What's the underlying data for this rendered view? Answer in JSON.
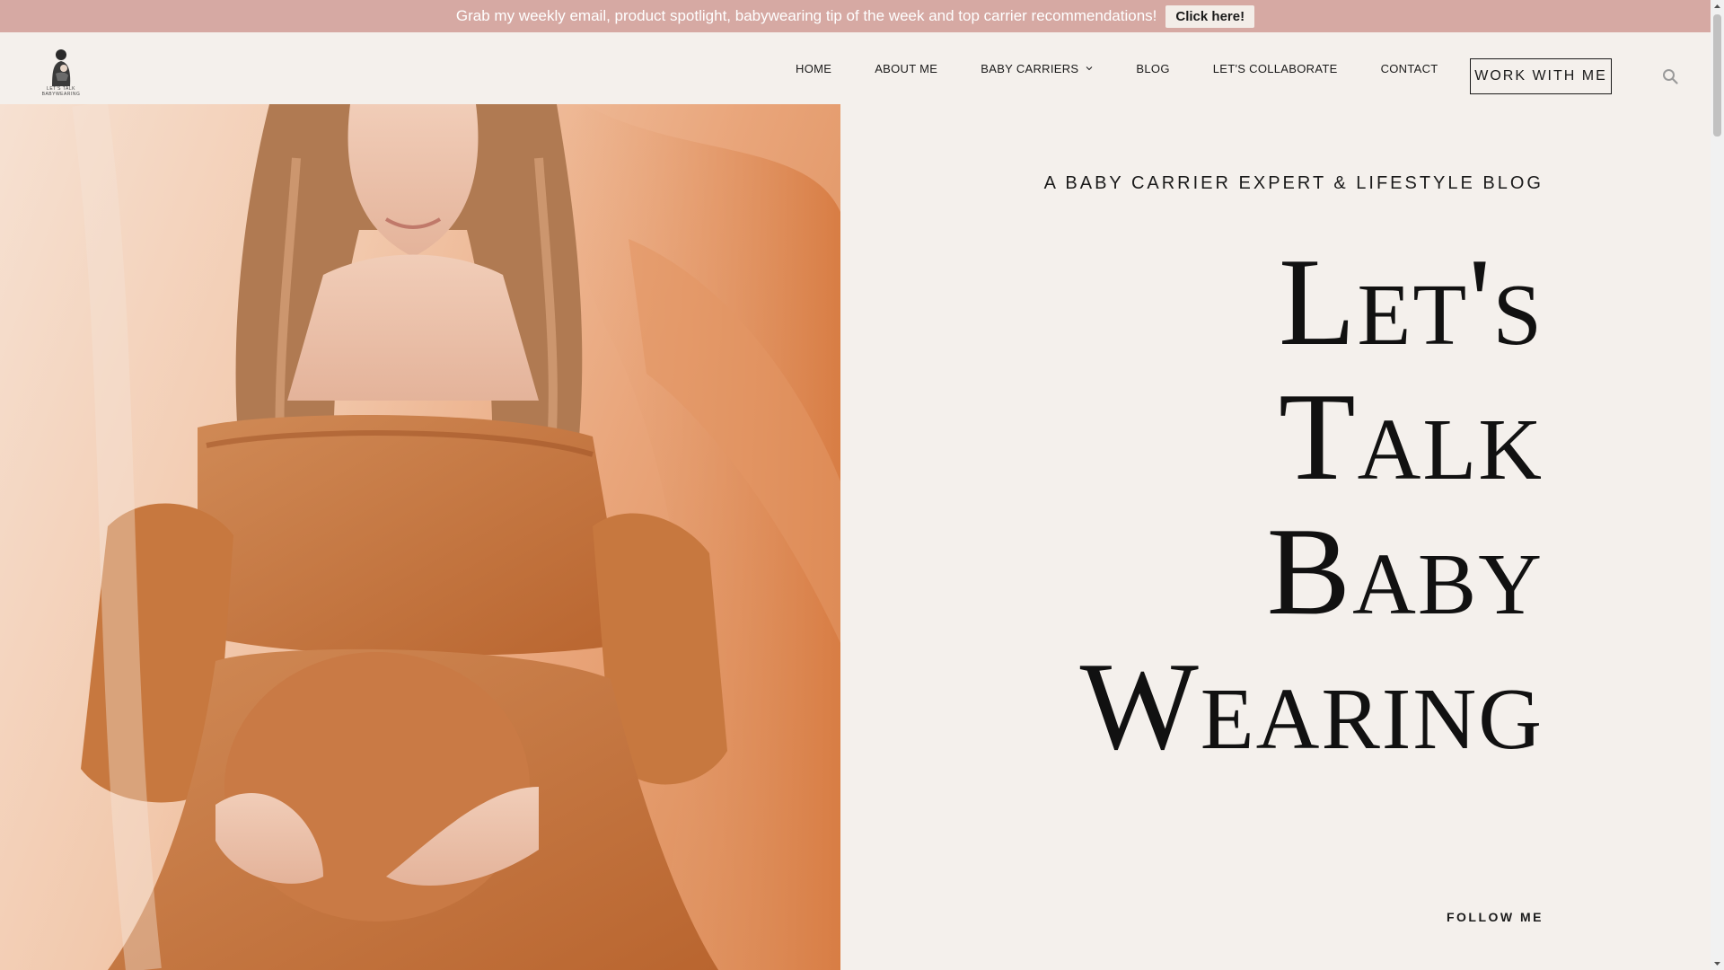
{
  "announcement": {
    "text": "Grab my weekly email, product spotlight, babywearing tip of the week and top carrier recommendations!",
    "button_label": "Click here!"
  },
  "logo": {
    "text": "LET'S TALK BABYWEARING"
  },
  "nav": {
    "items": [
      {
        "label": "HOME"
      },
      {
        "label": "ABOUT ME"
      },
      {
        "label": "BABY CARRIERS",
        "has_dropdown": true
      },
      {
        "label": "BLOG"
      },
      {
        "label": "LET'S COLLABORATE"
      },
      {
        "label": "CONTACT"
      }
    ],
    "cta_label": "WORK WITH ME"
  },
  "hero": {
    "tagline": "A BABY CARRIER EXPERT & LIFESTYLE BLOG",
    "headline_lines": [
      "Let's",
      "Talk",
      "Baby",
      "Wearing"
    ],
    "follow_label": "FOLLOW ME"
  },
  "colors": {
    "topbar": "#d6a9a3",
    "background": "#f4f0ec",
    "text": "#1a1a1a",
    "dress": "#c9733f"
  },
  "icons": {
    "search": "search-icon",
    "dropdown": "chevron-down-icon"
  }
}
